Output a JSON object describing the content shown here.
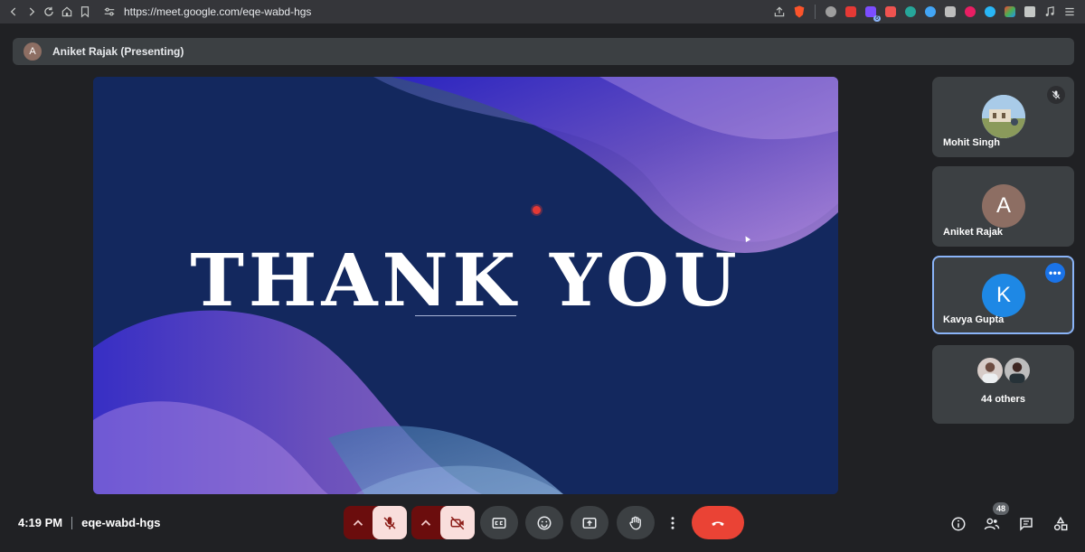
{
  "browser": {
    "url": "https://meet.google.com/eqe-wabd-hgs",
    "extension_badge": "6"
  },
  "presenting": {
    "avatar_initial": "A",
    "label": "Aniket Rajak (Presenting)"
  },
  "slide": {
    "title": "THANK YOU"
  },
  "participants": [
    {
      "name": "Mohit Singh",
      "muted": true
    },
    {
      "name": "Aniket Rajak",
      "initial": "A",
      "avatar_color": "#8d6e63"
    },
    {
      "name": "Kavya Gupta",
      "initial": "K",
      "avatar_color": "#1e88e5",
      "active": true
    }
  ],
  "others": {
    "label": "44 others"
  },
  "meeting": {
    "time": "4:19 PM",
    "code": "eqe-wabd-hgs"
  },
  "toolbar": {
    "people_count": "48"
  },
  "colors": {
    "background": "#202124",
    "tile": "#3c4043",
    "end_call": "#ea4335",
    "mic_off_bg": "#f9dedc",
    "active_border": "#8ab4f8"
  }
}
